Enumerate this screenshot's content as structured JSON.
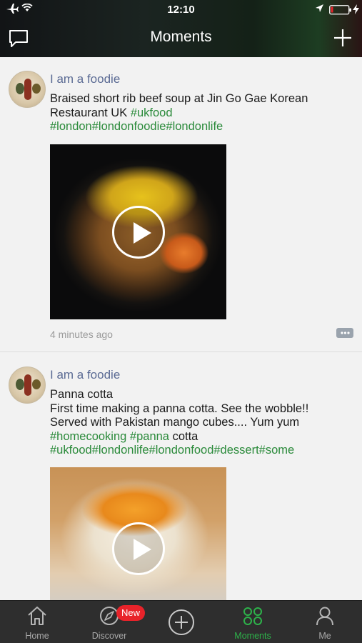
{
  "status_bar": {
    "time": "12:10"
  },
  "header": {
    "title": "Moments",
    "compose_icon": "chat-bubble-icon",
    "add_icon": "plus-icon"
  },
  "posts": [
    {
      "author": "I am a foodie",
      "text_lines": [
        [
          "Braised short rib beef soup at Jin Go Gae Korean"
        ],
        [
          "Restaurant UK ",
          "#ukfood"
        ],
        [
          "#london#londonfoodie#londonlife"
        ]
      ],
      "hashtags": [
        "#ukfood",
        "#london#londonfoodie#londonlife"
      ],
      "media": "video",
      "time_ago": "4 minutes ago"
    },
    {
      "author": "I am a foodie",
      "lines": {
        "l1": "Panna cotta",
        "l2": "First time making a panna cotta. See the wobble!!",
        "l3": "Served with Pakistan mango cubes.... Yum yum",
        "l4_tag1": "#homecooking",
        "l4_tag2": "#panna",
        "l4_text": " cotta",
        "l5_tag": "#ukfood#londonlife#londonfood#dessert#some"
      },
      "media": "video"
    }
  ],
  "post1_text": {
    "line1": "Braised short rib beef soup at Jin Go Gae Korean",
    "line2_text": "Restaurant UK ",
    "line2_tag": "#ukfood",
    "line3_tag": "#london#londonfoodie#londonlife"
  },
  "tabbar": {
    "items": [
      {
        "label": "Home",
        "icon": "house-icon"
      },
      {
        "label": "Discover",
        "icon": "compass-icon",
        "badge": "New"
      },
      {
        "label": "",
        "icon": "circle-plus-icon"
      },
      {
        "label": "Moments",
        "icon": "moments-icon",
        "active": true
      },
      {
        "label": "Me",
        "icon": "person-icon"
      }
    ]
  },
  "colors": {
    "accent": "#2db24a",
    "link": "#5b6b94",
    "hashtag": "#2a8a3a",
    "badge": "#e8232a"
  }
}
